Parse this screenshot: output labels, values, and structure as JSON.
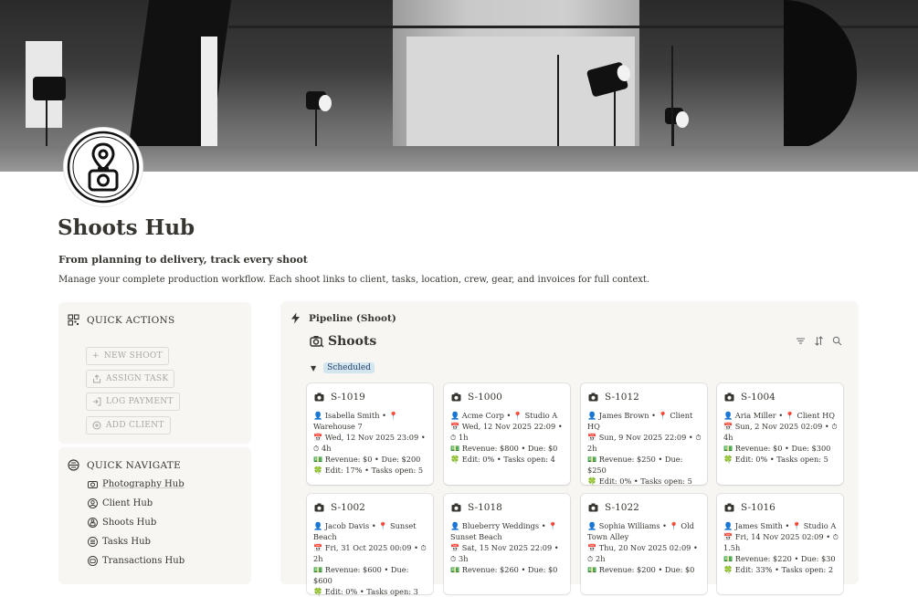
{
  "page": {
    "title": "Shoots Hub",
    "subtitle": "From planning to delivery, track every shoot",
    "description": "Manage your complete production workflow. Each shoot links to client, tasks, location, crew, gear, and invoices for full context."
  },
  "quick_actions": {
    "title": "QUICK ACTIONS",
    "buttons": [
      "NEW SHOOT",
      "ASSIGN TASK",
      "LOG PAYMENT",
      "ADD CLIENT"
    ]
  },
  "quick_navigate": {
    "title": "QUICK NAVIGATE",
    "items": [
      "Photography Hub",
      "Client Hub",
      "Shoots Hub",
      "Tasks Hub",
      "Transactions Hub"
    ]
  },
  "board": {
    "view_title": "Pipeline (Shoot)",
    "db_title": "Shoots",
    "group": "Scheduled",
    "cards": [
      {
        "id": "S-1019",
        "line1": "👤 Isabella Smith  •  📍 Warehouse 7",
        "line2": "📅 Wed, 12 Nov 2025 23:09  •  ⏱ 4h",
        "line3": "💵 Revenue: $0  •  Due: $200",
        "line4": "🍀 Edit: 17%  •  Tasks open: 5"
      },
      {
        "id": "S-1000",
        "line1": "👤 Acme Corp  •  📍 Studio A",
        "line2": "📅 Wed, 12 Nov 2025 22:09  •  ⏱ 1h",
        "line3": "💵 Revenue: $800  •  Due: $0",
        "line4": "🍀 Edit: 0%  •  Tasks open: 4"
      },
      {
        "id": "S-1012",
        "line1": "👤 James Brown  •  📍 Client HQ",
        "line2": "📅 Sun, 9 Nov 2025 22:09  •  ⏱ 2h",
        "line3": "💵 Revenue: $250  •  Due: $250",
        "line4": "🍀 Edit: 0%  •  Tasks open: 5"
      },
      {
        "id": "S-1004",
        "line1": "👤 Aria Miller  •  📍 Client HQ",
        "line2": "📅 Sun, 2 Nov 2025 02:09  •  ⏱ 4h",
        "line3": "💵 Revenue: $0  •  Due: $300",
        "line4": "🍀 Edit: 0%  •  Tasks open: 5"
      },
      {
        "id": "S-1002",
        "line1": "👤 Jacob Davis  •  📍 Sunset Beach",
        "line2": "📅 Fri, 31 Oct 2025 00:09  •  ⏱ 2h",
        "line3": "💵 Revenue: $600  •  Due: $600",
        "line4": "🍀 Edit: 0%  •  Tasks open: 3"
      },
      {
        "id": "S-1018",
        "line1": "👤 Blueberry Weddings  •  📍 Sunset Beach",
        "line2": "📅 Sat, 15 Nov 2025 22:09  •  ⏱ 3h",
        "line3": "💵 Revenue: $260  •  Due: $0",
        "line4": ""
      },
      {
        "id": "S-1022",
        "line1": "👤 Sophia Williams  •  📍 Old Town Alley",
        "line2": "📅 Thu, 20 Nov 2025 02:09  •  ⏱ 2h",
        "line3": "💵 Revenue: $200  •  Due: $0",
        "line4": ""
      },
      {
        "id": "S-1016",
        "line1": "👤 James Smith  •  📍 Studio A",
        "line2": "📅 Fri, 14 Nov 2025 02:09  •  ⏱ 1.5h",
        "line3": "💵 Revenue: $220  •  Due: $30",
        "line4": "🍀 Edit: 33%  •  Tasks open: 2"
      }
    ]
  }
}
